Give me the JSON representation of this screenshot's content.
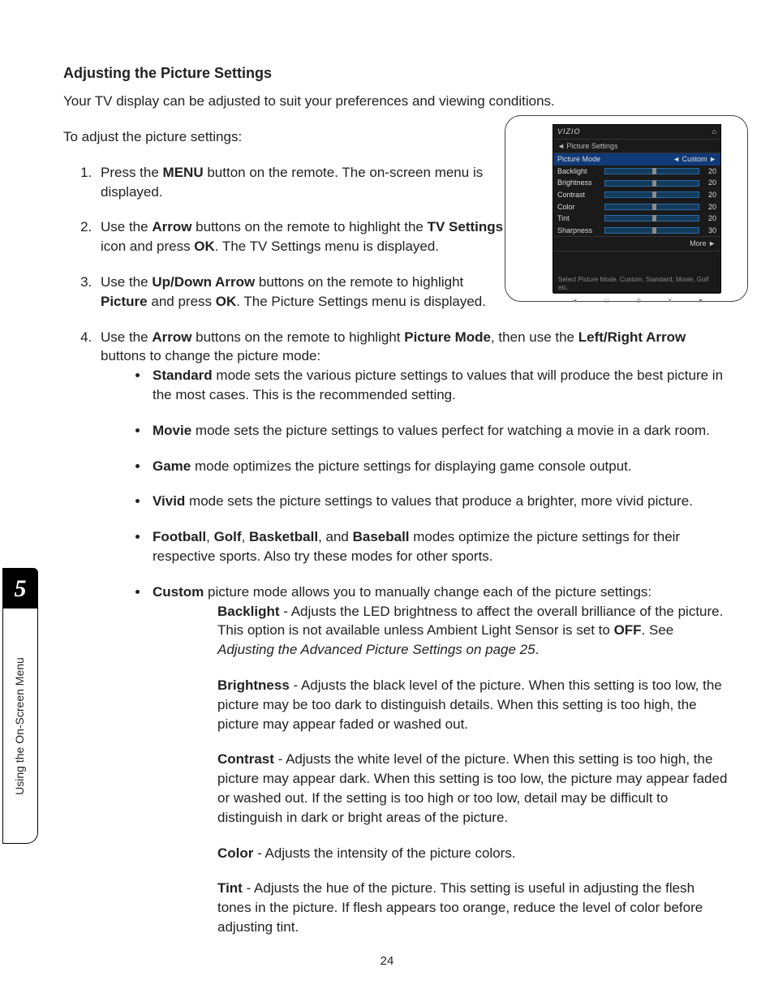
{
  "chapter": {
    "number": "5",
    "label": "Using the On-Screen Menu"
  },
  "page_number": "24",
  "heading": "Adjusting the Picture Settings",
  "intro": "Your TV display can be adjusted to suit your preferences and viewing conditions.",
  "lead": "To adjust the picture settings:",
  "steps": {
    "s1": {
      "b1": "MENU",
      "t1": "Press the ",
      "t2": " button on the remote. The on-screen menu is displayed."
    },
    "s2": {
      "b1": "Arrow",
      "b2": "TV Settings",
      "b3": "OK",
      "t1": "Use the ",
      "t2": " buttons on the remote to highlight the ",
      "t3": " icon and press ",
      "t4": ". The TV Settings menu is displayed."
    },
    "s3": {
      "b1": "Up/Down Arrow",
      "b2": "Picture",
      "b3": "OK",
      "t1": "Use the ",
      "t2": " buttons on the remote to highlight ",
      "t3": " and press ",
      "t4": ". The Picture Settings menu is displayed."
    },
    "s4": {
      "b1": "Arrow",
      "b2": "Picture Mode",
      "b3": "Left/Right Arrow",
      "t1": "Use the ",
      "t2": " buttons on the remote to highlight ",
      "t3": ", then use the ",
      "t4": " buttons to change the picture mode:"
    }
  },
  "modes": {
    "standard": {
      "b": "Standard",
      "t": " mode sets the various picture settings to values that will produce the best picture in the most cases. This is the recommended setting."
    },
    "movie": {
      "b": "Movie",
      "t": " mode sets the picture settings to values perfect for watching a movie in a dark room."
    },
    "game": {
      "b": "Game",
      "t": " mode optimizes the picture settings for displaying game console output."
    },
    "vivid": {
      "b": "Vivid",
      "t": " mode sets the picture settings to values that produce a brighter, more vivid picture."
    },
    "sports": {
      "b1": "Football",
      "b2": "Golf",
      "b3": "Basketball",
      "b4": "Baseball",
      "t1": ", ",
      "t2": ", ",
      "t3": ", and ",
      "t4": " modes optimize the picture settings for their respective sports. Also try these modes for other sports."
    },
    "custom": {
      "b": "Custom",
      "t": " picture mode allows you to manually change each of the picture settings:"
    }
  },
  "defs": {
    "backlight": {
      "b": "Backlight",
      "off": "OFF",
      "t1": " - Adjusts the LED brightness to affect the overall brilliance of the picture. This option is not available unless Ambient Light Sensor is set to ",
      "t2": ". See ",
      "ital": "Adjusting the Advanced Picture Settings on page 25",
      "t3": "."
    },
    "brightness": {
      "b": "Brightness",
      "t": " - Adjusts the black level of the picture. When this setting is too low, the picture may be too dark to distinguish details. When this setting is too high, the picture may appear faded or washed out."
    },
    "contrast": {
      "b": "Contrast",
      "t": " - Adjusts the white level of the picture. When this setting is too high, the picture may appear dark. When this setting is too low, the picture may appear faded or washed out. If the setting is too high or too low, detail may be difficult to distinguish in dark or bright areas of the picture."
    },
    "color": {
      "b": "Color",
      "t": " - Adjusts the intensity of the picture colors."
    },
    "tint": {
      "b": "Tint",
      "t": " - Adjusts the hue of the picture. This setting is useful in adjusting the flesh tones in the picture. If flesh appears too orange, reduce the level of color before adjusting tint."
    }
  },
  "tv": {
    "brand": "VIZIO",
    "home": "⌂",
    "crumb": "◄  Picture Settings",
    "rows": [
      {
        "label": "Picture Mode",
        "value": "◄ Custom ►",
        "slider": false
      },
      {
        "label": "Backlight",
        "value": "20",
        "slider": true
      },
      {
        "label": "Brightness",
        "value": "20",
        "slider": true
      },
      {
        "label": "Contrast",
        "value": "20",
        "slider": true
      },
      {
        "label": "Color",
        "value": "20",
        "slider": true
      },
      {
        "label": "Tint",
        "value": "20",
        "slider": true
      },
      {
        "label": "Sharpness",
        "value": "30",
        "slider": true
      }
    ],
    "more": "More   ►",
    "hint": "Select Picture Mode. Custom, Standard, Movie, Golf etc.",
    "icons": [
      "◄",
      "▭",
      "⊘",
      "✕",
      "■"
    ]
  }
}
